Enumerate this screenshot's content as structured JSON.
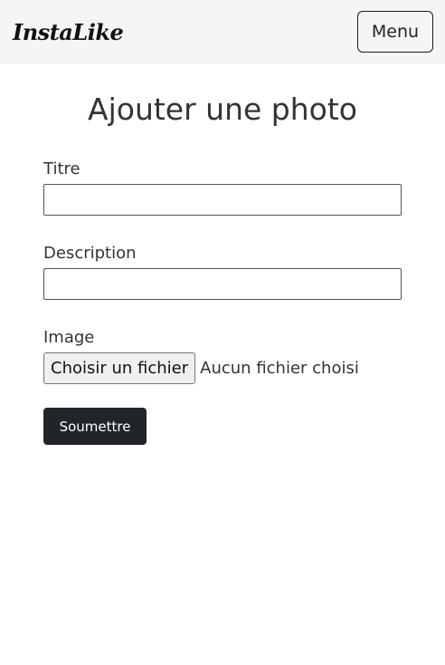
{
  "navbar": {
    "brand": "InstaLike",
    "menu_label": "Menu"
  },
  "page": {
    "title": "Ajouter une photo"
  },
  "form": {
    "title_label": "Titre",
    "title_value": "",
    "description_label": "Description",
    "description_value": "",
    "image_label": "Image",
    "file_button_label": "Choisir un fichier",
    "file_status": "Aucun fichier choisi",
    "submit_label": "Soumettre"
  }
}
